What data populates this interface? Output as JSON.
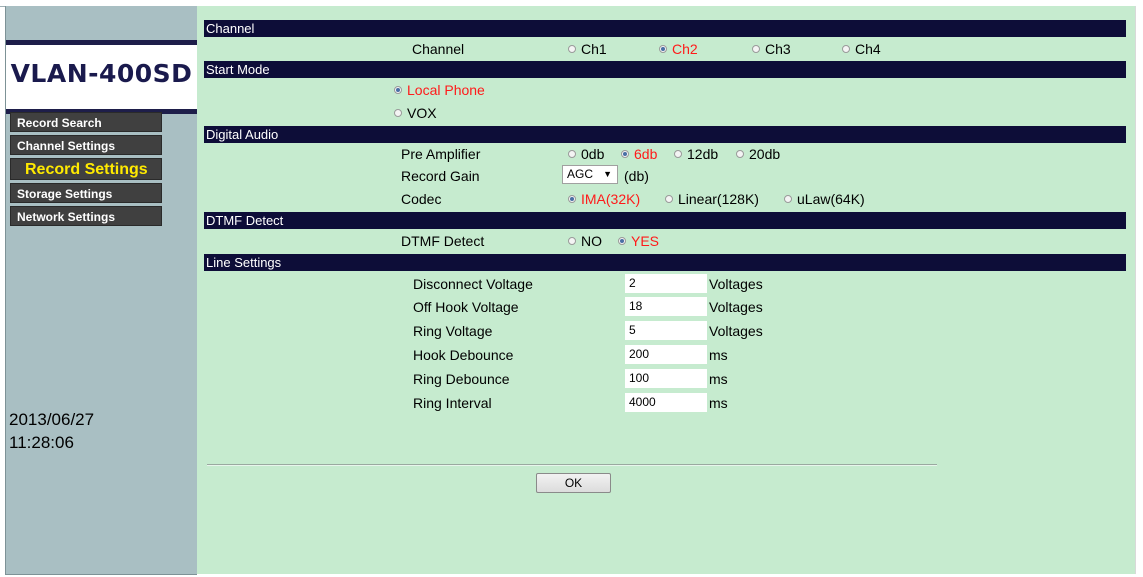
{
  "sidebar": {
    "logo": "VLAN-400SD",
    "nav": [
      {
        "label": "Record Search",
        "active": false
      },
      {
        "label": "Channel Settings",
        "active": false
      },
      {
        "label": "Record Settings",
        "active": true
      },
      {
        "label": "Storage Settings",
        "active": false
      },
      {
        "label": "Network Settings",
        "active": false
      }
    ],
    "date": "2013/06/27",
    "time": "11:28:06"
  },
  "sections": {
    "channel": "Channel",
    "start_mode": "Start Mode",
    "digital_audio": "Digital Audio",
    "dtmf_detect": "DTMF Detect",
    "line_settings": "Line Settings"
  },
  "channel": {
    "label": "Channel",
    "options": [
      "Ch1",
      "Ch2",
      "Ch3",
      "Ch4"
    ],
    "selected": "Ch2"
  },
  "start_mode": {
    "options": [
      "Local Phone",
      "VOX"
    ],
    "selected": "Local Phone"
  },
  "digital_audio": {
    "pre_amplifier_label": "Pre Amplifier",
    "pre_amplifier_options": [
      "0db",
      "6db",
      "12db",
      "20db"
    ],
    "pre_amplifier_selected": "6db",
    "record_gain_label": "Record Gain",
    "record_gain_value": "AGC",
    "record_gain_unit": "(db)",
    "codec_label": "Codec",
    "codec_options": [
      "IMA(32K)",
      "Linear(128K)",
      "uLaw(64K)"
    ],
    "codec_selected": "IMA(32K)"
  },
  "dtmf": {
    "label": "DTMF Detect",
    "options": [
      "NO",
      "YES"
    ],
    "selected": "YES"
  },
  "line_settings": [
    {
      "label": "Disconnect Voltage",
      "value": "2",
      "unit": "Voltages"
    },
    {
      "label": "Off Hook Voltage",
      "value": "18",
      "unit": "Voltages"
    },
    {
      "label": "Ring Voltage",
      "value": "5",
      "unit": "Voltages"
    },
    {
      "label": "Hook Debounce",
      "value": "200",
      "unit": "ms"
    },
    {
      "label": "Ring Debounce",
      "value": "100",
      "unit": "ms"
    },
    {
      "label": "Ring Interval",
      "value": "4000",
      "unit": "ms"
    }
  ],
  "ok_button": "OK",
  "colors": {
    "sidebar_bg": "#a9bfc3",
    "main_bg": "#c6ebcf",
    "section_bar": "#0d0d38",
    "selected_option": "#ff1a1a",
    "active_nav": "#ffea00"
  }
}
